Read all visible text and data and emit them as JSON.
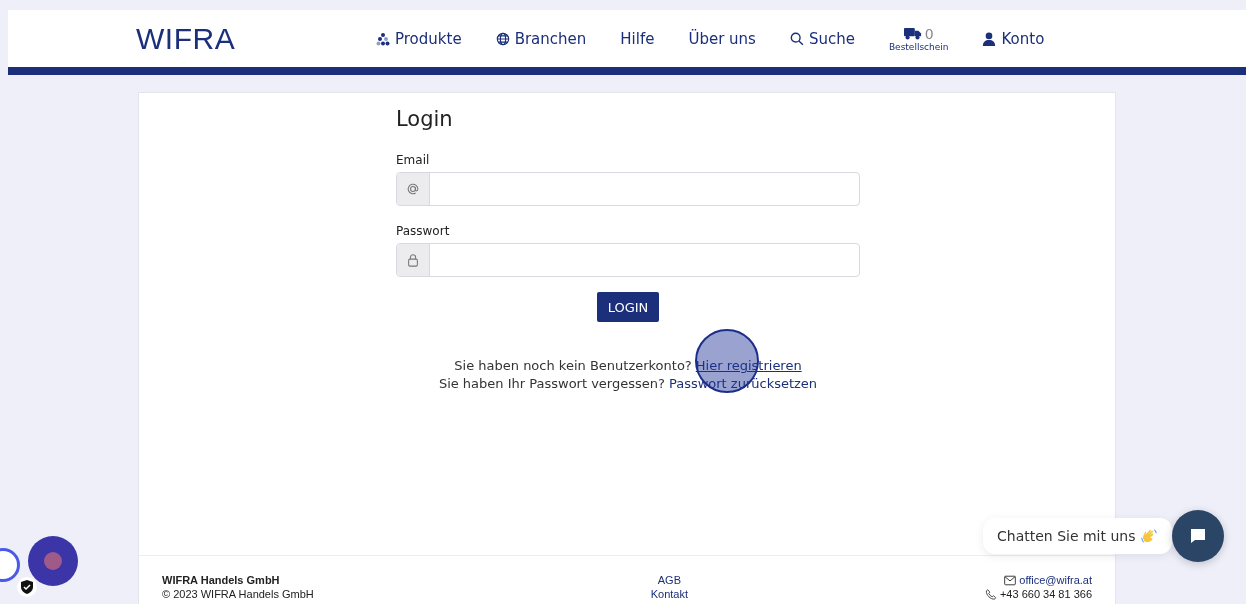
{
  "header": {
    "logo": "WIFRA",
    "nav": [
      {
        "kind": "products",
        "label": "Produkte"
      },
      {
        "kind": "globe",
        "label": "Branchen"
      },
      {
        "kind": "plain",
        "label": "Hilfe"
      },
      {
        "kind": "plain",
        "label": "Über uns"
      },
      {
        "kind": "search",
        "label": "Suche"
      }
    ],
    "order": {
      "count": "0",
      "label": "Bestellschein"
    },
    "account": {
      "label": "Konto"
    }
  },
  "login": {
    "title": "Login",
    "fields": [
      {
        "kind": "email",
        "label": "Email"
      },
      {
        "kind": "password",
        "label": "Passwort"
      }
    ],
    "button": "LOGIN",
    "lines": [
      {
        "text": "Sie haben noch kein Benutzerkonto?",
        "link": "Hier registrieren",
        "underline": true
      },
      {
        "text": "Sie haben Ihr Passwort vergessen?",
        "link": "Passwort zurücksetzen",
        "underline": false
      }
    ]
  },
  "footer": {
    "company": "WIFRA Handels GmbH",
    "copyright": "© 2023 WIFRA Handels GmbH",
    "links": [
      "AGB",
      "Kontakt"
    ],
    "email": "office@wifra.at",
    "phone": "+43 660 34 81 366"
  },
  "chat": {
    "label": "Chatten Sie mit uns"
  }
}
